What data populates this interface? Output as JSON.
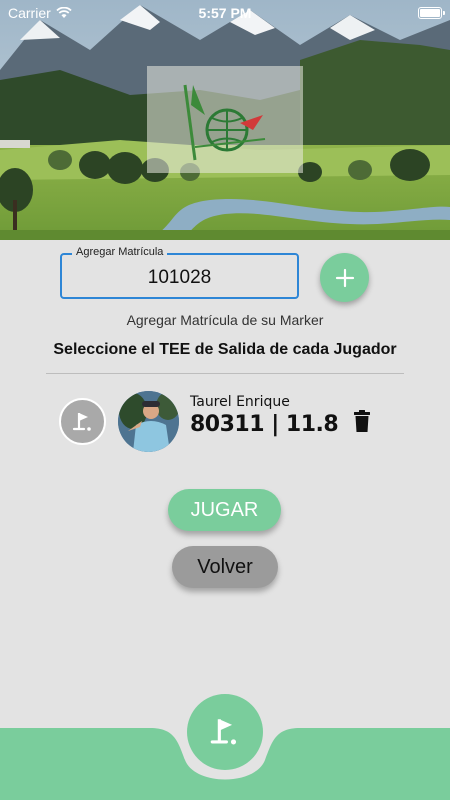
{
  "status_bar": {
    "carrier": "Carrier",
    "time": "5:57 PM"
  },
  "matricula": {
    "label": "Agregar Matrícula",
    "value": "101028"
  },
  "helper_text": "Agregar Matrícula de su Marker",
  "section_title": "Seleccione el TEE de Salida de cada Jugador",
  "player": {
    "name": "Taurel Enrique",
    "stats": "80311 | 11.8"
  },
  "buttons": {
    "jugar": "JUGAR",
    "volver": "Volver"
  },
  "colors": {
    "accent_green": "#7acd9c",
    "input_border": "#2e86d6",
    "background": "#e3e3e3"
  }
}
